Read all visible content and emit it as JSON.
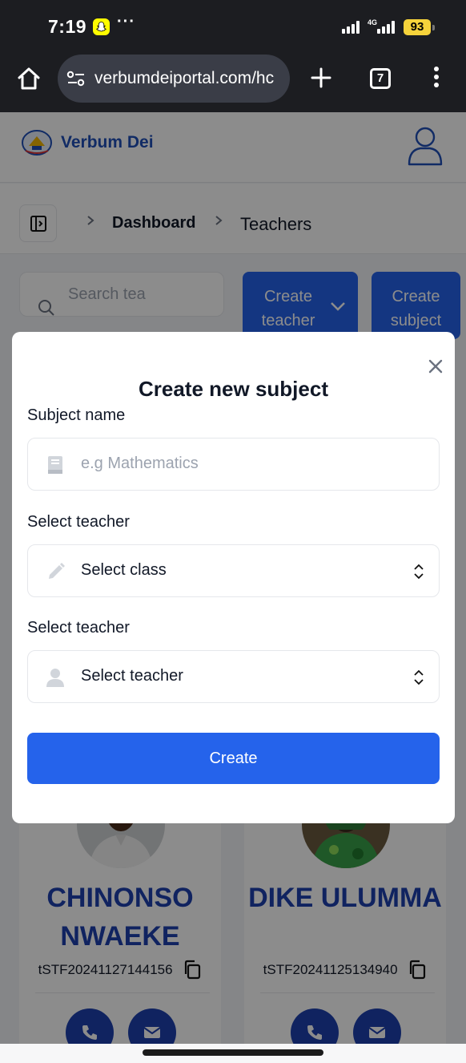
{
  "status": {
    "time": "7:19",
    "more": "···",
    "network": "4G",
    "battery": "93"
  },
  "browser": {
    "url": "verbumdeiportal.com/hc",
    "tab_count": "7"
  },
  "header": {
    "brand": "Verbum Dei"
  },
  "breadcrumb": {
    "items": [
      "Dashboard",
      "Teachers"
    ]
  },
  "toolbar": {
    "search_placeholder": "Search tea",
    "create_teacher_label": "Create teacher",
    "create_subject_label": "Create subject"
  },
  "teachers": [
    {
      "name": "CHINONSO NWAEKE",
      "code": "tSTF20241127144156"
    },
    {
      "name": "DIKE ULUMMA",
      "code": "tSTF20241125134940"
    }
  ],
  "modal": {
    "title": "Create new subject",
    "subject_name_label": "Subject name",
    "subject_name_placeholder": "e.g Mathematics",
    "class_label": "Select teacher",
    "class_value": "Select class",
    "teacher_label": "Select teacher",
    "teacher_value": "Select teacher",
    "submit_label": "Create"
  },
  "colors": {
    "primary": "#2563eb",
    "brand": "#1f4fb8",
    "card_name": "#1e40af"
  }
}
